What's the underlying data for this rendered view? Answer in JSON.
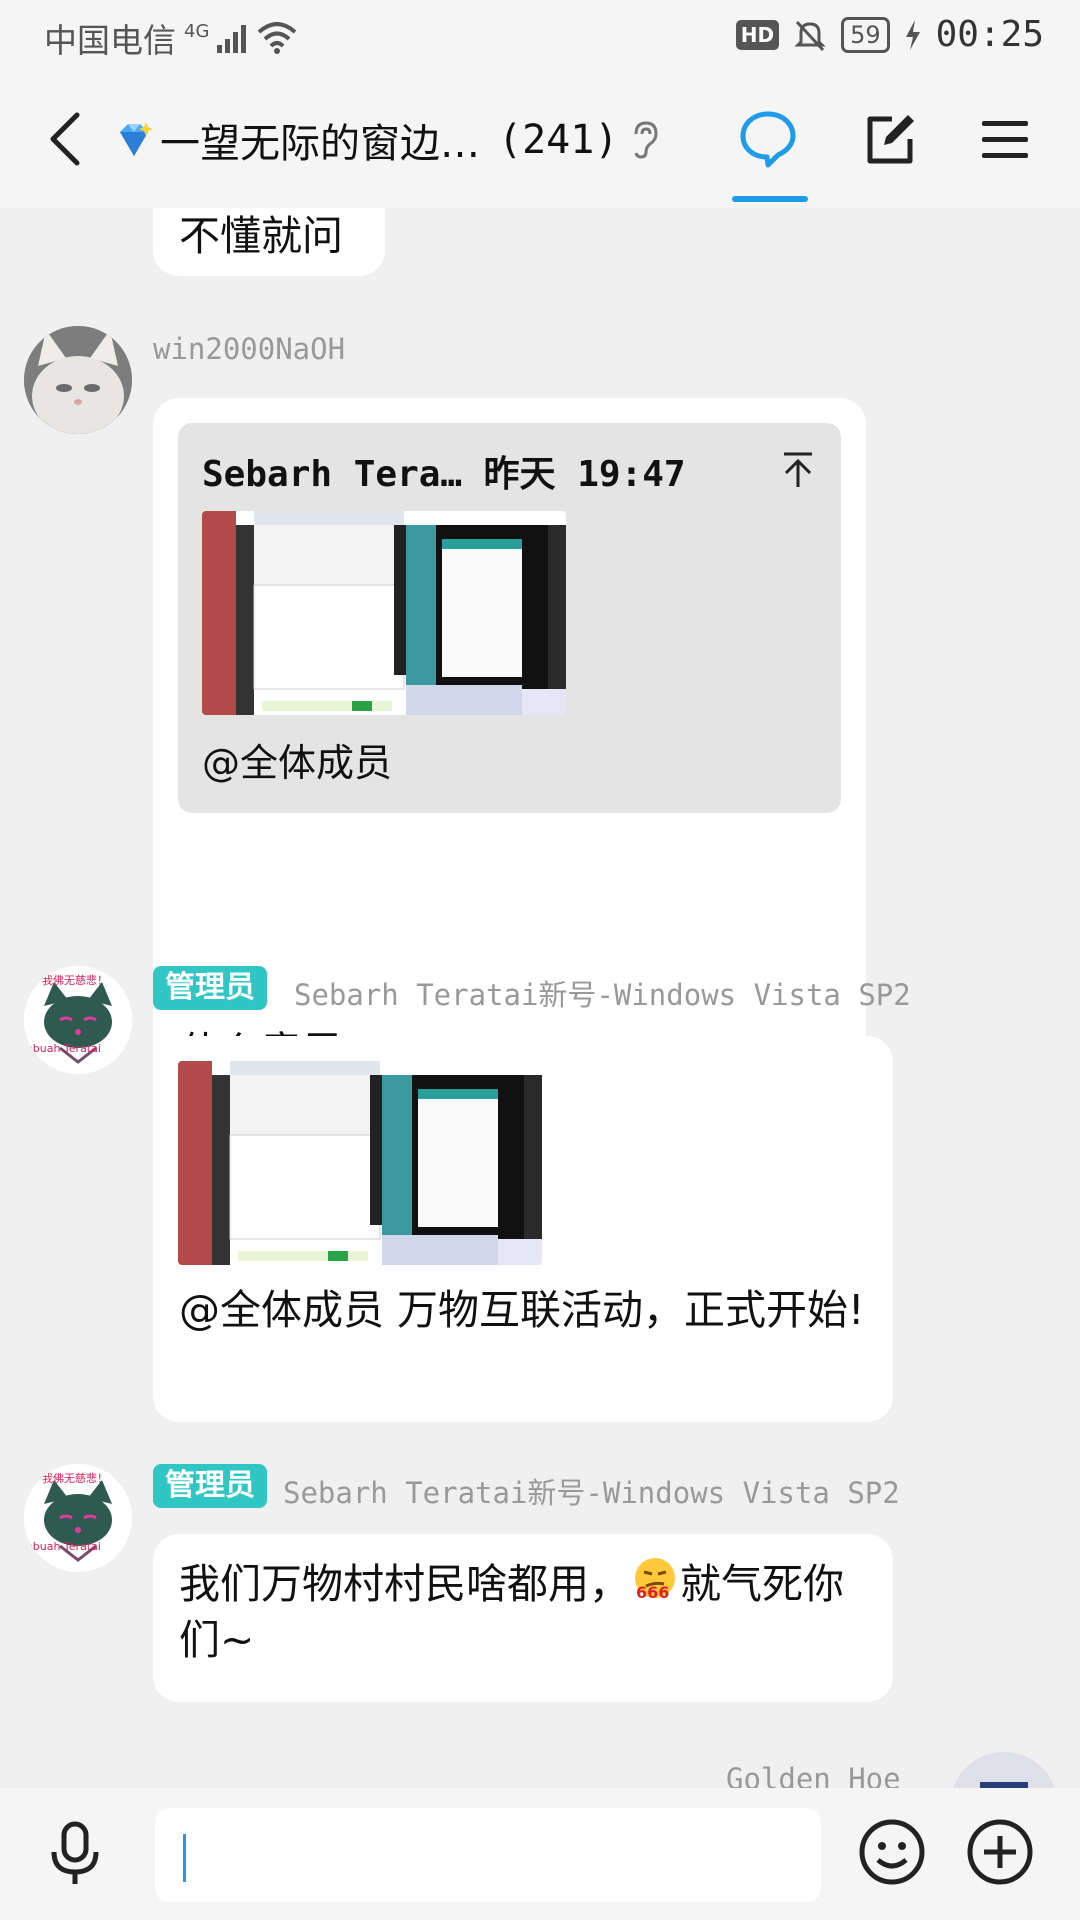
{
  "status_bar": {
    "carrier": "中国电信",
    "network": "4G",
    "battery": "59",
    "time": "00:25",
    "hd": "HD"
  },
  "header": {
    "title": "一望无际的窗边…",
    "member_count": "(241)"
  },
  "messages": [
    {
      "text": "不懂就问"
    },
    {
      "sender": "win2000NaOH",
      "quote_sender": "Sebarh Tera…",
      "quote_time": "昨天 19:47",
      "quote_text": "@全体成员",
      "text": "什么意思"
    },
    {
      "badge": "管理员",
      "sender": "Sebarh Teratai新号-Windows Vista SP2",
      "text": "@全体成员  万物互联活动，正式开始!"
    },
    {
      "badge": "管理员",
      "sender": "Sebarh Teratai新号-Windows Vista SP2",
      "text_before": "我们万物村村民啥都用，",
      "emoji_label": "666",
      "text_after": "就气死你们~"
    },
    {
      "sender": "Golden_Hoe"
    }
  ],
  "avatar_text": {
    "top": "我佛无慈悲！",
    "bottom": "ebuah Teratai"
  },
  "colors": {
    "accent": "#1e9be9",
    "admin_badge": "#2fc6c4",
    "background": "#f0f0f0"
  }
}
